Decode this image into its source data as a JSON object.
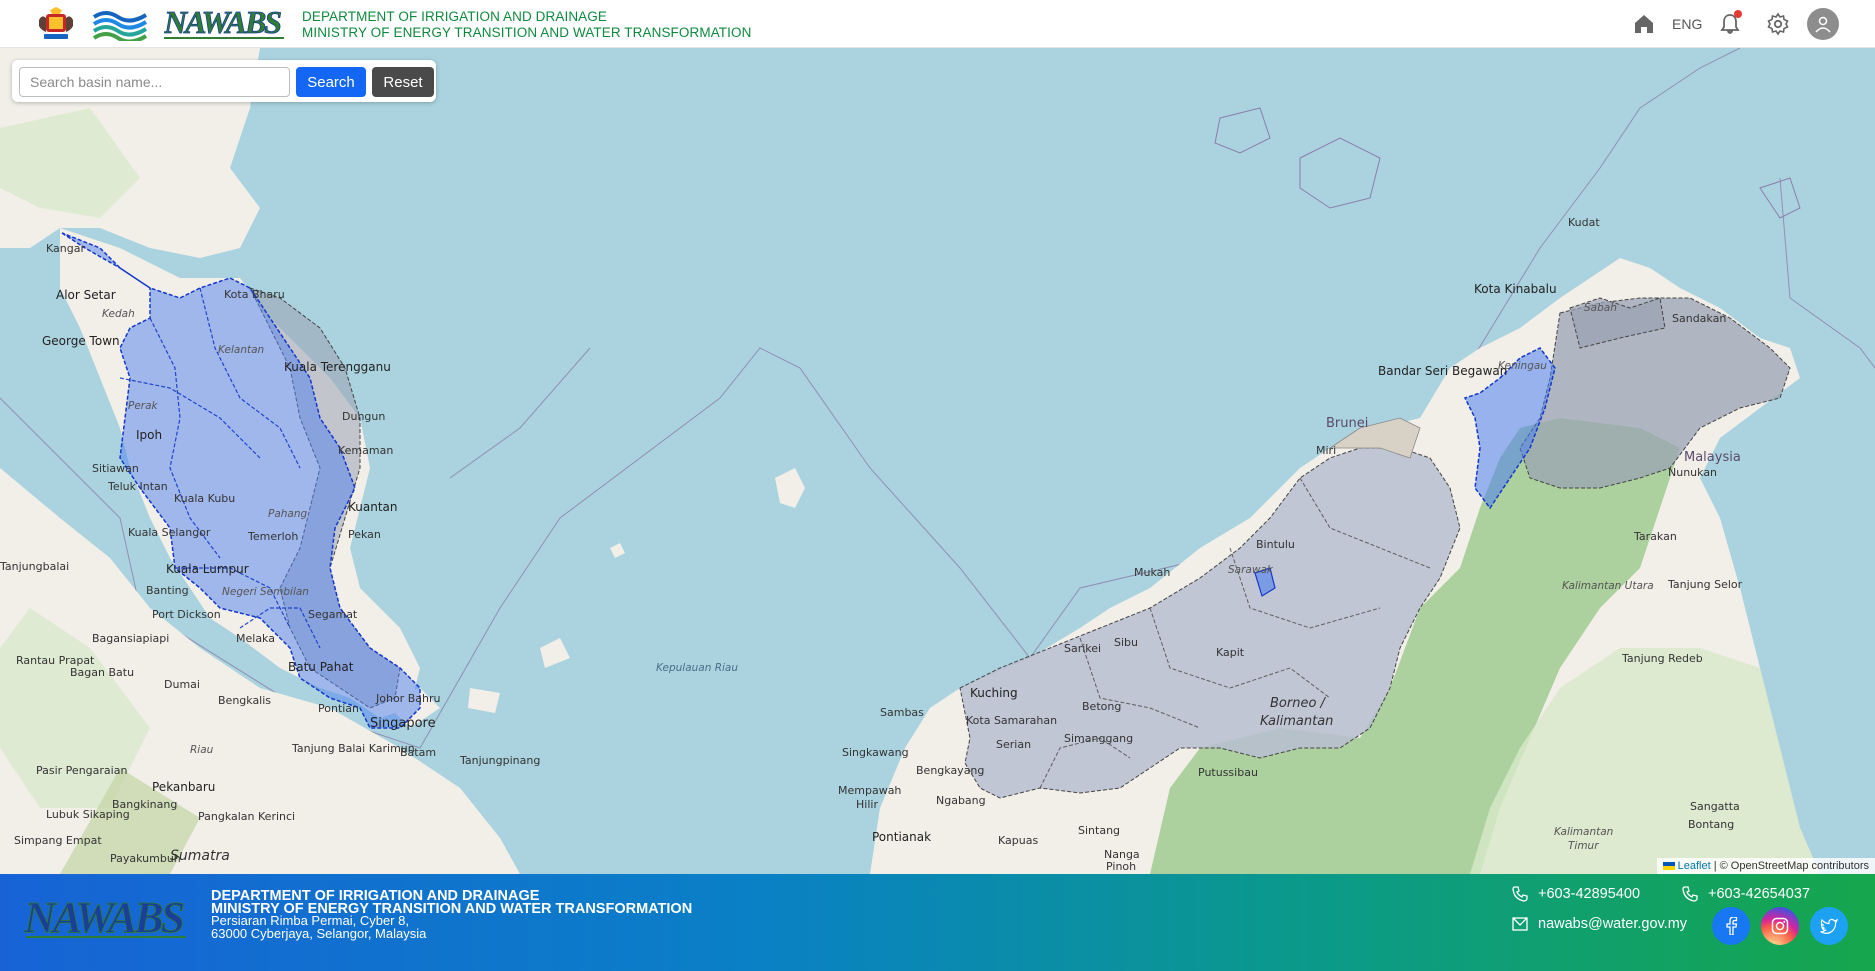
{
  "header": {
    "dept_line": "DEPARTMENT OF IRRIGATION AND DRAINAGE",
    "ministry_line": "MINISTRY OF ENERGY TRANSITION AND WATER TRANSFORMATION",
    "logo_text": "NAWABS",
    "language": "ENG",
    "icons": [
      "home-icon",
      "bell-icon",
      "gear-icon",
      "user-icon"
    ]
  },
  "search": {
    "placeholder": "Search basin name...",
    "value": "",
    "search_label": "Search",
    "reset_label": "Reset"
  },
  "map": {
    "labels": {
      "kangar": "Kangar",
      "alor_setar": "Alor Setar",
      "george_town": "George Town",
      "ipoh": "Ipoh",
      "sitiawan": "Sitiawan",
      "teluk_intan": "Teluk Intan",
      "kuala_kubu": "Kuala Kubu",
      "kuala_selangor": "Kuala Selangor",
      "kuala_lumpur": "Kuala Lumpur",
      "banting": "Banting",
      "port_dickson": "Port Dickson",
      "melaka": "Melaka",
      "batu_pahat": "Batu Pahat",
      "johor": "Johor Bahru",
      "singapore": "Singapore",
      "kota_bharu": "Kota Bharu",
      "kuala_terengganu": "Kuala Terengganu",
      "dungun": "Dungun",
      "kemaman": "Kemaman",
      "kuantan": "Kuantan",
      "pekan": "Pekan",
      "temerloh": "Temerloh",
      "segamat": "Segamat",
      "pontian": "Pontian",
      "batam": "Batam",
      "tanjungpinang": "Tanjungpinang",
      "tanjung_balai_karimun": "Tanjung Balai Karimun",
      "tanjungbalai": "Tanjungbalai",
      "bagansiapiapi": "Bagansiapiapi",
      "rantau_prapat": "Rantau Prapat",
      "bagan_batu": "Bagan Batu",
      "dumai": "Dumai",
      "bengkalis": "Bengkalis",
      "pasir_pengaraian": "Pasir Pengaraian",
      "bangkinang": "Bangkinang",
      "pekanbaru": "Pekanbaru",
      "lubuk_sikaping": "Lubuk Sikaping",
      "pangkalan_kerinci": "Pangkalan Kerinci",
      "simpang_empat": "Simpang Empat",
      "payakumbuh": "Payakumbuh",
      "sumatra": "Sumatra",
      "riau": "Riau",
      "kepulauan_riau": "Kepulauan Riau",
      "perak": "Perak",
      "kedah": "Kedah",
      "kelantan": "Kelantan",
      "pahang": "Pahang",
      "negeri_sembilan": "Negeri Sembilan",
      "kota_kinabalu": "Kota Kinabalu",
      "kudat": "Kudat",
      "sandakan": "Sandakan",
      "sabah": "Sabah",
      "keningau": "Keningau",
      "malaysia": "Malaysia",
      "nunukan": "Nunukan",
      "tarakan": "Tarakan",
      "tanjung_selor": "Tanjung Selor",
      "kalimantan_utara": "Kalimantan Utara",
      "tanjung_redeb": "Tanjung Redeb",
      "bandar_seri_begawan": "Bandar Seri Begawan",
      "brunei": "Brunei",
      "miri": "Miri",
      "bintulu": "Bintulu",
      "sarawak": "Sarawak",
      "mukah": "Mukah",
      "sibu": "Sibu",
      "sarikei": "Sarikei",
      "kapit": "Kapit",
      "kuching": "Kuching",
      "kota_samarahan": "Kota Samarahan",
      "serian": "Serian",
      "betong": "Betong",
      "simanggang": "Simanggang",
      "borneo": "Borneo /",
      "kalimantan": "Kalimantan",
      "sambas": "Sambas",
      "singkawang": "Singkawang",
      "bengkayang": "Bengkayang",
      "mempawah": "Mempawah",
      "hilir": "Hilir",
      "ngabang": "Ngabang",
      "pontianak": "Pontianak",
      "putussibau": "Putussibau",
      "sintang": "Sintang",
      "kapuas": "Kapuas",
      "nanga_pinoh": "Nanga",
      "pinoh": "Pinoh",
      "sangatta": "Sangatta",
      "bontang": "Bontang",
      "kalimantan_timur": "Kalimantan",
      "timur": "Timur"
    },
    "attribution_leaflet": "Leaflet",
    "attribution_rest": "| © OpenStreetMap contributors"
  },
  "footer": {
    "logo_text": "NAWABS",
    "dept_line": "DEPARTMENT OF IRRIGATION AND DRAINAGE",
    "ministry_line": "MINISTRY OF ENERGY TRANSITION AND WATER TRANSFORMATION",
    "address_line1": "Persiaran Rimba Permai, Cyber 8,",
    "address_line2": "63000 Cyberjaya, Selangor, Malaysia",
    "phone1": "+603-42895400",
    "phone2": "+603-42654037",
    "email": "nawabs@water.gov.my",
    "social": [
      "facebook-icon",
      "instagram-icon",
      "twitter-icon"
    ]
  },
  "colors": {
    "header_text": "#0e8a3e",
    "search_button": "#1466f5",
    "reset_button": "#4a4a4a",
    "basin_selected": "#4d7ff0",
    "basin_other": "#9aa3b3",
    "sea": "#aad3df"
  }
}
